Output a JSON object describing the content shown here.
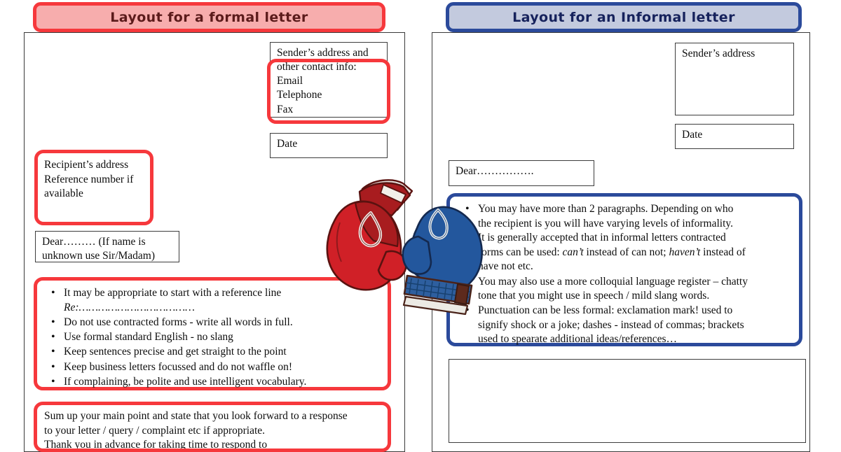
{
  "document": {
    "title_formal": "Layout for a formal letter",
    "title_informal": "Layout for an Informal letter"
  },
  "formal": {
    "banner_label": "Layout for a formal letter",
    "sender_box": {
      "line1": "Sender’s address and",
      "line2": "other contact info:",
      "line3": "Email",
      "line4": "Telephone",
      "line5": "Fax"
    },
    "date_box": {
      "label": "Date"
    },
    "recipient_box": {
      "line1": "Recipient’s address",
      "line2": "Reference number if",
      "line3": "available"
    },
    "salutation_box": {
      "line1": "Dear……… (If name is",
      "line2": "unknown use Sir/Madam)"
    },
    "body_bullets": [
      {
        "text": "It may be appropriate to start with a reference line",
        "sub": "Re:………………………………"
      },
      {
        "text": "Do not use contracted forms - write all words in full.",
        "sub": ""
      },
      {
        "text": "Use formal standard English - no slang",
        "sub": ""
      },
      {
        "text": "Keep sentences precise and get straight to the point",
        "sub": ""
      },
      {
        "text": "Keep business letters focussed and do not waffle on!",
        "sub": ""
      },
      {
        "text": "If complaining, be polite and use intelligent vocabulary.",
        "sub": ""
      }
    ],
    "closing_box": {
      "line1": "Sum up your main point and state that you look forward to a response",
      "line2": "to your letter / query / complaint etc if appropriate.",
      "line3": "Thank you in advance for taking time to respond to"
    }
  },
  "informal": {
    "banner_label": "Layout for an Informal letter",
    "sender_box": {
      "label": "Sender’s address"
    },
    "date_box": {
      "label": "Date"
    },
    "salutation_box": {
      "label": "Dear……………."
    },
    "body_bullets": [
      {
        "lines": [
          "You may have more than 2 paragraphs. Depending on who",
          "the recipient is you will have varying levels of informality.",
          "It is generally accepted that in informal letters contracted"
        ],
        "mixed_line_pre": "forms can be used: ",
        "mixed_italic_1": "can’t",
        "mixed_mid": " instead of can not; ",
        "mixed_italic_2": "haven’t",
        "mixed_post": " instead of",
        "tail_line": "have not etc."
      },
      {
        "lines": [
          "You may also use a more colloquial language register – chatty",
          "tone that you might use in speech / mild slang words."
        ]
      },
      {
        "lines": [
          "Punctuation can be less formal: exclamation mark! used to",
          "signify shock or a joke; dashes -  instead of commas; brackets",
          "used to spearate additional ideas/references…"
        ]
      }
    ],
    "empty_box": {
      "label": ""
    }
  },
  "graphics": {
    "gloves_icon": "boxing-gloves",
    "glove_left_color": "#cf2026",
    "glove_right_color": "#23579d"
  },
  "colors": {
    "formal_accent": "#f6383c",
    "formal_fill": "#f7adad",
    "informal_accent": "#2b4a9b",
    "informal_fill": "#c3cade",
    "page_border": "#3a3a3a",
    "text": "#0d0d0d"
  }
}
